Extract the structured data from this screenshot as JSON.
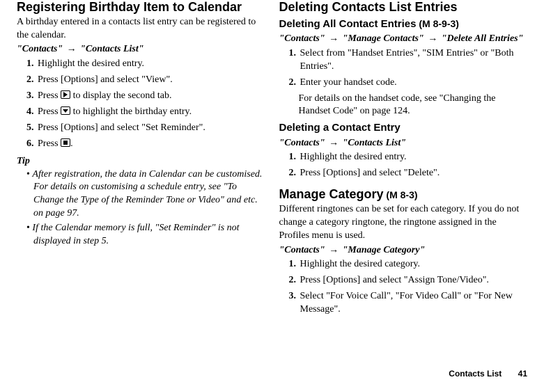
{
  "left": {
    "h2": "Registering Birthday Item to Calendar",
    "intro": "A birthday entered in a contacts list entry can be registered to the calendar.",
    "crumb": {
      "a": "\"Contacts\"",
      "b": "\"Contacts List\""
    },
    "steps": [
      "Highlight the desired entry.",
      "Press [Options] and select \"View\".",
      {
        "pre": "Press ",
        "icon": "right",
        "post": " to display the second tab."
      },
      {
        "pre": "Press ",
        "icon": "down",
        "post": " to highlight the birthday entry."
      },
      "Press [Options] and select \"Set Reminder\".",
      {
        "pre": "Press ",
        "icon": "center",
        "post": "."
      }
    ],
    "tipHeading": "Tip",
    "tips": [
      "After registration, the data in Calendar can be customised. For details on customising a schedule entry, see \"To Change the Type of the Reminder Tone or Video\"  and etc. on page 97.",
      "If the Calendar memory is full, \"Set Reminder\" is not displayed in step 5."
    ]
  },
  "right": {
    "h2": "Deleting Contacts List Entries",
    "sectA": {
      "h3": "Deleting All Contact Entries",
      "menucode": " (M 8-9-3)",
      "crumb": {
        "a": "\"Contacts\"",
        "b": "\"Manage Contacts\"",
        "c": "\"Delete All Entries\""
      },
      "steps": [
        "Select from \"Handset Entries\", \"SIM Entries\" or \"Both Entries\".",
        "Enter your handset code."
      ],
      "sub": "For details on the handset code, see \"Changing the Handset Code\" on page 124."
    },
    "sectB": {
      "h3": "Deleting a Contact Entry",
      "crumb": {
        "a": "\"Contacts\"",
        "b": "\"Contacts List\""
      },
      "steps": [
        "Highlight the desired entry.",
        "Press [Options] and select \"Delete\"."
      ]
    },
    "sectC": {
      "h2": "Manage Category",
      "menucode": " (M 8-3)",
      "intro": "Different ringtones can be set for each category. If you do not change a category ringtone, the ringtone assigned in the Profiles menu is used.",
      "crumb": {
        "a": "\"Contacts\"",
        "b": "\"Manage Category\""
      },
      "steps": [
        "Highlight the desired category.",
        "Press [Options] and select \"Assign Tone/Video\".",
        "Select \"For Voice Call\", \"For Video Call\" or \"For New Message\"."
      ]
    }
  },
  "footer": {
    "title": "Contacts List",
    "page": "41"
  }
}
